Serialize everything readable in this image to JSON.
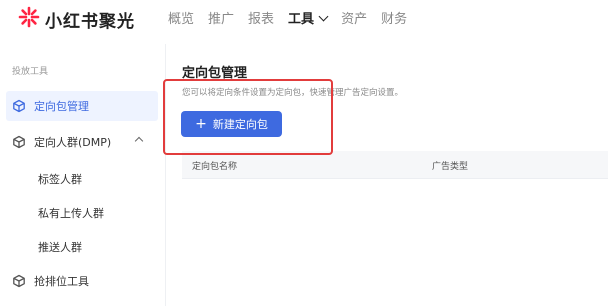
{
  "app": {
    "logo_text": "小红书聚光"
  },
  "nav": {
    "items": [
      {
        "label": "概览",
        "active": false
      },
      {
        "label": "推广",
        "active": false
      },
      {
        "label": "报表",
        "active": false
      },
      {
        "label": "工具",
        "active": true
      },
      {
        "label": "资产",
        "active": false
      },
      {
        "label": "财务",
        "active": false
      }
    ]
  },
  "sidebar": {
    "section_label": "投放工具",
    "items": [
      {
        "label": "定向包管理",
        "active": true
      },
      {
        "label": "定向人群(DMP)",
        "expanded": true
      },
      {
        "label": "抢排位工具"
      }
    ],
    "sub_items": [
      {
        "label": "标签人群"
      },
      {
        "label": "私有上传人群"
      },
      {
        "label": "推送人群"
      }
    ]
  },
  "main": {
    "title": "定向包管理",
    "description": "您可以将定向条件设置为定向包，快速管理广告定向设置。",
    "new_button_label": "新建定向包",
    "table": {
      "columns": [
        "定向包名称",
        "广告类型"
      ]
    }
  },
  "colors": {
    "accent": "#3e6ae0",
    "highlight_box": "#e23c3c",
    "logo_red": "#ff2442"
  }
}
